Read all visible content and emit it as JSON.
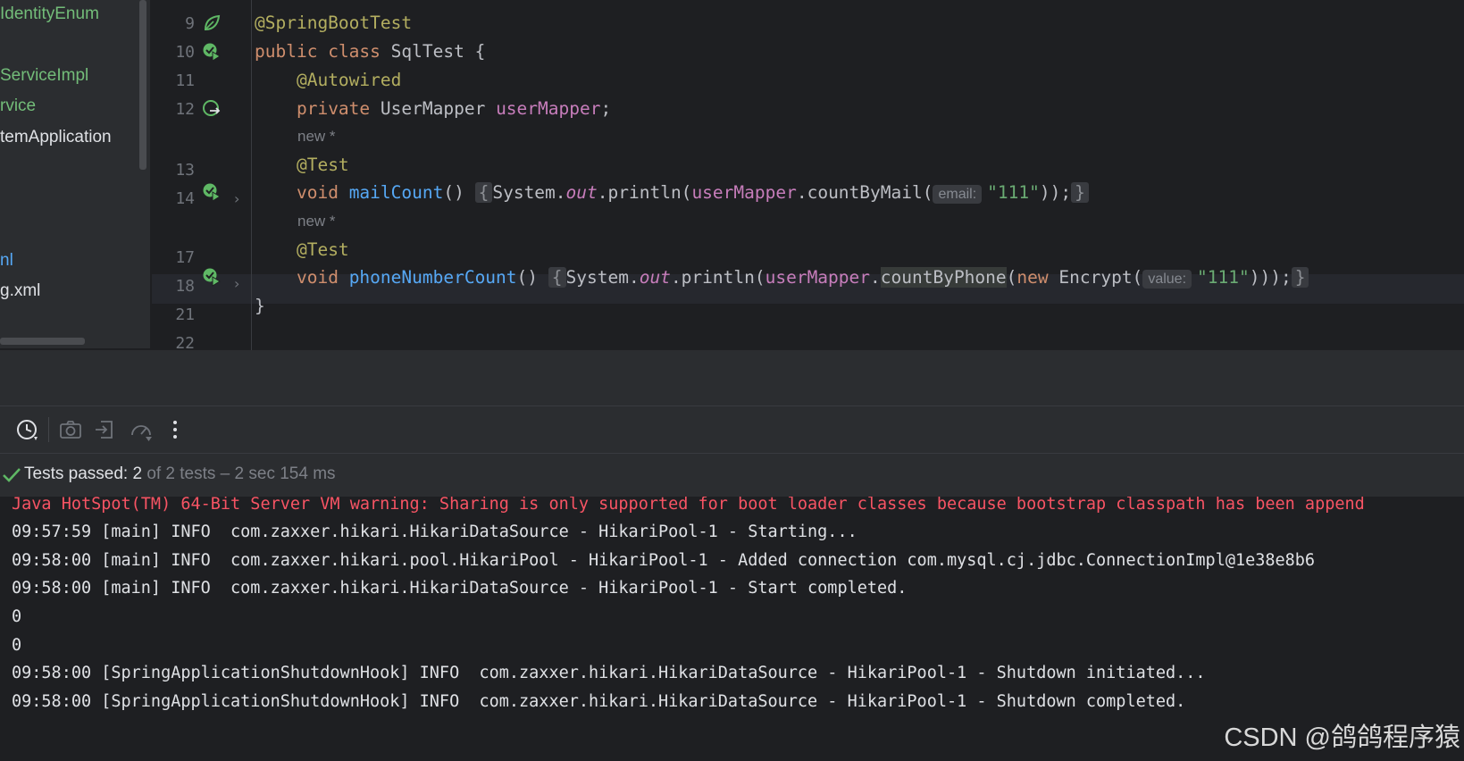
{
  "project_tree": {
    "items": [
      "IdentityEnum",
      "ServiceImpl",
      "rvice",
      "temApplication",
      "nl",
      "g.xml"
    ]
  },
  "editor": {
    "line_numbers": [
      "9",
      "10",
      "11",
      "12",
      "13",
      "14",
      "17",
      "18",
      "21",
      "22"
    ],
    "hint_new": "new *",
    "lines": {
      "l9": {
        "annotation": "@SpringBootTest"
      },
      "l10": {
        "kw1": "public",
        "kw2": "class",
        "name": "SqlTest",
        "brace": "{"
      },
      "l11": {
        "annotation": "@Autowired"
      },
      "l12": {
        "kw": "private",
        "type": "UserMapper",
        "field": "userMapper",
        "semi": ";"
      },
      "l13": {
        "annotation": "@Test"
      },
      "l14": {
        "kw": "void",
        "method": "mailCount",
        "parens": "()",
        "open": "{",
        "sys": "System.",
        "out": "out",
        "println": ".println(",
        "field": "userMapper",
        "call": ".countByMail(",
        "hint": "email:",
        "str": "\"111\"",
        "close": "));",
        "end": "}"
      },
      "l17": {
        "annotation": "@Test"
      },
      "l18": {
        "kw": "void",
        "method": "phoneNumberCount",
        "parens": "()",
        "open": "{",
        "sys": "System.",
        "out": "out",
        "println": ".println(",
        "field": "userMapper",
        "dot": ".",
        "call": "countByPhone",
        "paren": "(",
        "new_kw": "new",
        "ctor": " Encrypt(",
        "hint": "value:",
        "str": "\"111\"",
        "close": ")));",
        "end": "}"
      },
      "l21": {
        "brace": "}"
      }
    }
  },
  "test_status": {
    "passed_label": "Tests passed:",
    "passed_count": "2",
    "rest": "of 2 tests – 2 sec 154 ms"
  },
  "toolbar": {
    "icons": [
      "history-icon",
      "camera-icon",
      "export-icon",
      "coverage-icon",
      "more-icon"
    ]
  },
  "console": {
    "warning": "Java HotSpot(TM) 64-Bit Server VM warning: Sharing is only supported for boot loader classes because bootstrap classpath has been append",
    "lines": [
      "09:57:59 [main] INFO  com.zaxxer.hikari.HikariDataSource - HikariPool-1 - Starting...",
      "09:58:00 [main] INFO  com.zaxxer.hikari.pool.HikariPool - HikariPool-1 - Added connection com.mysql.cj.jdbc.ConnectionImpl@1e38e8b6",
      "09:58:00 [main] INFO  com.zaxxer.hikari.HikariDataSource - HikariPool-1 - Start completed.",
      "0",
      "0",
      "09:58:00 [SpringApplicationShutdownHook] INFO  com.zaxxer.hikari.HikariDataSource - HikariPool-1 - Shutdown initiated...",
      "09:58:00 [SpringApplicationShutdownHook] INFO  com.zaxxer.hikari.HikariDataSource - HikariPool-1 - Shutdown completed."
    ]
  },
  "watermark": "CSDN @鸽鸽程序猿",
  "colors": {
    "background": "#1e1f22",
    "panel": "#2b2d30",
    "annotation": "#b3ae60",
    "keyword": "#cf8e6d",
    "method": "#56a8f5",
    "field": "#c77dbb",
    "string": "#6aab73",
    "success": "#5fb865",
    "warning": "#f75464",
    "tree_green": "#73bd79"
  }
}
